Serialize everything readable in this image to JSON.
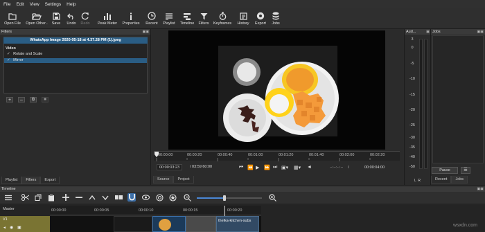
{
  "menu": [
    "File",
    "Edit",
    "View",
    "Settings",
    "Help"
  ],
  "toolbar": [
    {
      "label": "Open File",
      "icon": "folder-icon",
      "enabled": true
    },
    {
      "label": "Open Other..",
      "icon": "folder-open-icon",
      "enabled": true
    },
    {
      "label": "Save",
      "icon": "save-icon",
      "enabled": true
    },
    {
      "label": "Undo",
      "icon": "undo-icon",
      "enabled": false
    },
    {
      "label": "Redo",
      "icon": "redo-icon",
      "enabled": false
    },
    {
      "label": "Peak Meter",
      "icon": "peak-meter-icon",
      "enabled": true
    },
    {
      "label": "Properties",
      "icon": "info-icon",
      "enabled": true
    },
    {
      "label": "Recent",
      "icon": "clock-icon",
      "enabled": true
    },
    {
      "label": "Playlist",
      "icon": "playlist-icon",
      "enabled": true
    },
    {
      "label": "Timeline",
      "icon": "timeline-icon",
      "enabled": true
    },
    {
      "label": "Filters",
      "icon": "filter-icon",
      "enabled": true
    },
    {
      "label": "Keyframes",
      "icon": "stopwatch-icon",
      "enabled": true
    },
    {
      "label": "History",
      "icon": "history-icon",
      "enabled": true
    },
    {
      "label": "Export",
      "icon": "export-icon",
      "enabled": true
    },
    {
      "label": "Jobs",
      "icon": "jobs-icon",
      "enabled": true
    }
  ],
  "filters_panel": {
    "title": "Filters",
    "clip_title": "WhatsApp Image 2020-05-18 at 4.37.28 PM (1).jpeg",
    "section": "Video",
    "items": [
      {
        "label": "Rotate and Scale",
        "checked": true
      },
      {
        "label": "Mirror",
        "checked": true,
        "selected": true
      }
    ],
    "tabs": [
      "Playlist",
      "Filters",
      "Export"
    ]
  },
  "viewer": {
    "ruler_ticks": [
      "00:00:00",
      "00:00:20",
      "00:00:40",
      "00:01:00",
      "00:01:20",
      "00:01:40",
      "00:02:00",
      "00:02:20"
    ],
    "current_time": "00:00:03:23",
    "duration": "/ 03:59:60:00",
    "in_point": "--:--:--:--",
    "separator": "/",
    "out_point": "00:00:04:00",
    "tabs": [
      "Source",
      "Project"
    ]
  },
  "audio": {
    "title": "Aud...",
    "scale": [
      "3",
      "0",
      "-5",
      "-10",
      "-15",
      "-20",
      "-25",
      "-30",
      "-35",
      "-40",
      "-50"
    ],
    "channels": "L  R"
  },
  "jobs": {
    "title": "Jobs",
    "pause_label": "Pause",
    "menu_label": "☰",
    "tabs": [
      "Recent",
      "Jobs"
    ]
  },
  "timeline": {
    "title": "Timeline",
    "master_label": "Master",
    "track_label": "V1",
    "ruler_ticks": [
      "00:00:00",
      "00:00:05",
      "00:00:10",
      "00:00:15",
      "00:00:20"
    ],
    "clip_text": "thelka-kitchen-subs"
  },
  "colors": {
    "selection": "#2a5d84",
    "track_header": "#7a7433",
    "panel_bg": "#2b2b2b",
    "accent_blue": "#4a88d6"
  },
  "watermark": "wsxdn.com"
}
